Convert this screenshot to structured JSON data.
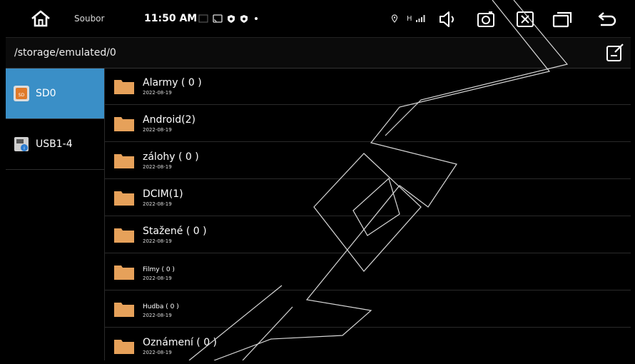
{
  "status_bar": {
    "app_title": "Soubor",
    "time": "11:50 AM",
    "signal_text": "H"
  },
  "path_bar": {
    "path": "/storage/emulated/0"
  },
  "sidebar": {
    "items": [
      {
        "label": "SD0",
        "active": true
      },
      {
        "label": "USB1-4",
        "active": false
      }
    ]
  },
  "files": [
    {
      "name": "Alarmy ( 0 )",
      "date": "2022-08-19"
    },
    {
      "name": "Android(2)",
      "date": "2022-08-19"
    },
    {
      "name": "zálohy ( 0 )",
      "date": "2022-08-19"
    },
    {
      "name": "DCIM(1)",
      "date": "2022-08-19"
    },
    {
      "name": "Stažené ( 0 )",
      "date": "2022-08-19"
    },
    {
      "name": "Filmy ( 0 )",
      "date": "2022-08-19"
    },
    {
      "name": "Hudba ( 0 )",
      "date": "2022-08-19"
    },
    {
      "name": "Oznámení ( 0 )",
      "date": "2022-08-19"
    }
  ],
  "colors": {
    "accent": "#3a8fc7",
    "folder": "#e6a15a",
    "background": "#000000"
  }
}
